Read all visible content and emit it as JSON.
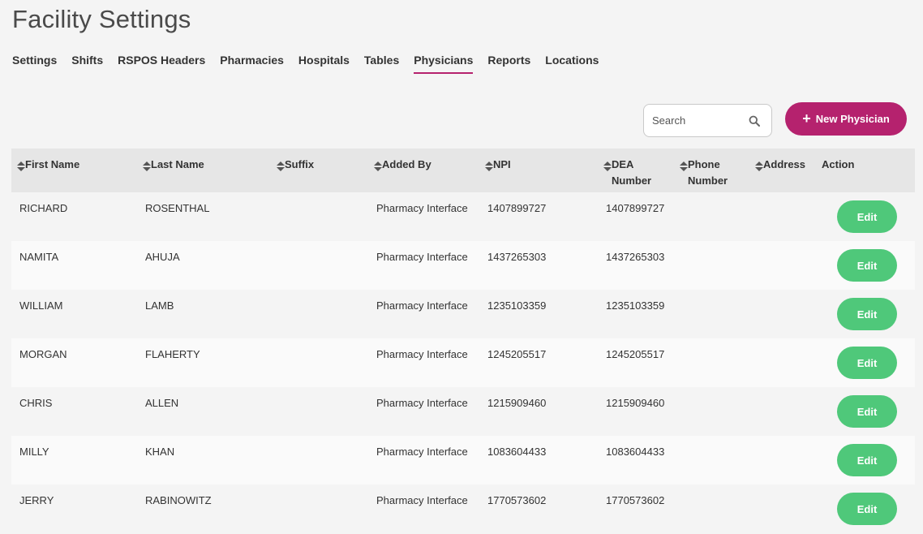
{
  "page": {
    "title": "Facility Settings"
  },
  "tabs": [
    {
      "label": "Settings"
    },
    {
      "label": "Shifts"
    },
    {
      "label": "RSPOS Headers"
    },
    {
      "label": "Pharmacies"
    },
    {
      "label": "Hospitals"
    },
    {
      "label": "Tables"
    },
    {
      "label": "Physicians",
      "active": true
    },
    {
      "label": "Reports"
    },
    {
      "label": "Locations"
    }
  ],
  "toolbar": {
    "search_placeholder": "Search",
    "new_button_label": "New Physician",
    "search_icon": "search-icon",
    "plus_icon": "plus-icon"
  },
  "table": {
    "columns": [
      {
        "label": "First Name",
        "sortable": true
      },
      {
        "label": "Last Name",
        "sortable": true
      },
      {
        "label": "Suffix",
        "sortable": true
      },
      {
        "label": "Added By",
        "sortable": true
      },
      {
        "label": "NPI",
        "sortable": true
      },
      {
        "label": "DEA Number",
        "sortable": true
      },
      {
        "label": "Phone Number",
        "sortable": true
      },
      {
        "label": "Address",
        "sortable": true
      },
      {
        "label": "Action",
        "sortable": false
      }
    ],
    "rows": [
      {
        "first": "RICHARD",
        "last": "ROSENTHAL",
        "suffix": "",
        "added_by": "Pharmacy Interface",
        "npi": "1407899727",
        "dea": "1407899727",
        "phone": "",
        "address": "",
        "action": "Edit"
      },
      {
        "first": "NAMITA",
        "last": "AHUJA",
        "suffix": "",
        "added_by": "Pharmacy Interface",
        "npi": "1437265303",
        "dea": "1437265303",
        "phone": "",
        "address": "",
        "action": "Edit"
      },
      {
        "first": "WILLIAM",
        "last": "LAMB",
        "suffix": "",
        "added_by": "Pharmacy Interface",
        "npi": "1235103359",
        "dea": "1235103359",
        "phone": "",
        "address": "",
        "action": "Edit"
      },
      {
        "first": "MORGAN",
        "last": "FLAHERTY",
        "suffix": "",
        "added_by": "Pharmacy Interface",
        "npi": "1245205517",
        "dea": "1245205517",
        "phone": "",
        "address": "",
        "action": "Edit"
      },
      {
        "first": "CHRIS",
        "last": "ALLEN",
        "suffix": "",
        "added_by": "Pharmacy Interface",
        "npi": "1215909460",
        "dea": "1215909460",
        "phone": "",
        "address": "",
        "action": "Edit"
      },
      {
        "first": "MILLY",
        "last": "KHAN",
        "suffix": "",
        "added_by": "Pharmacy Interface",
        "npi": "1083604433",
        "dea": "1083604433",
        "phone": "",
        "address": "",
        "action": "Edit"
      },
      {
        "first": "JERRY",
        "last": "RABINOWITZ",
        "suffix": "",
        "added_by": "Pharmacy Interface",
        "npi": "1770573602",
        "dea": "1770573602",
        "phone": "",
        "address": "",
        "action": "Edit"
      }
    ]
  },
  "colors": {
    "accent": "#b5226e",
    "edit_button": "#4fc87a",
    "header_row": "#e6e6e6",
    "background": "#f4f4f4"
  }
}
